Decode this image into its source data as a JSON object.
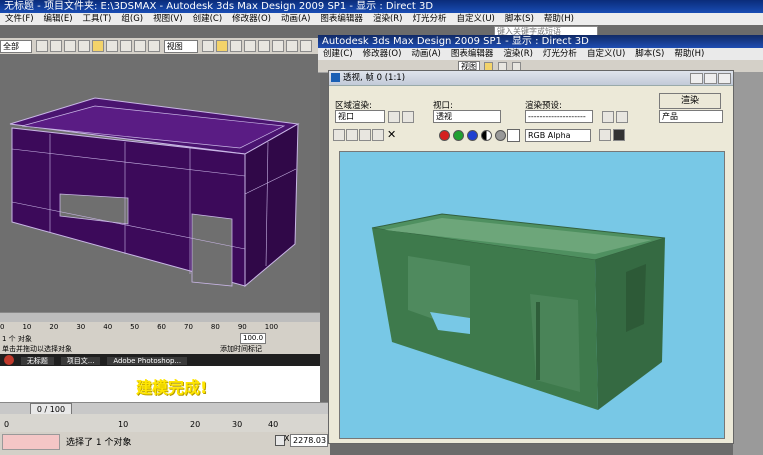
{
  "main": {
    "title": "无标题    - 项目文件夹: E:\\3DSMAX      - Autodesk 3ds Max Design 2009 SP1      - 显示 : Direct 3D",
    "menu": [
      "文件(F)",
      "编辑(E)",
      "工具(T)",
      "组(G)",
      "视图(V)",
      "创建(C)",
      "修改器(O)",
      "动画(A)",
      "图表编辑器",
      "渲染(R)",
      "灯光分析",
      "自定义(U)",
      "脚本(S)",
      "帮助(H)"
    ],
    "search_placeholder": "键入关键字或短语",
    "toolbar_combo_left": "全部",
    "toolbar_combo_view": "视图",
    "inner_title": "E:\\3DSMAX     - Autodesk 3ds Max Design 2009 SP1     - 显示 : Direct 3D",
    "inner_menu": [
      "文件(F)",
      "编辑(E)",
      "工具(T)",
      "组(G)",
      "视图(V)",
      "创建(C)",
      "修改器(O)",
      "动画(A)",
      "图表编辑器",
      "渲染(R)",
      "灯光分析",
      "自定义(U)",
      "脚本(S)",
      "帮助(H)"
    ],
    "frame_counter": "0 / 100",
    "small_frame_counter": "0 / 100",
    "selection_status": "选择了 1 个对象",
    "small_selection_status": "1 个 对象",
    "small_prompt": "单击并拖动以选择对象",
    "coord_x": "2278.03",
    "ruler": [
      "0",
      "10",
      "20",
      "30",
      "40"
    ],
    "small_ruler": [
      "0",
      "10",
      "20",
      "30",
      "40",
      "50",
      "60",
      "70",
      "80",
      "90",
      "100"
    ],
    "right_panel_label": "添加时间标记",
    "zoom_value": "100.0"
  },
  "taskbar": {
    "items": [
      "无标题",
      "项目文...",
      "Adobe Photoshop..."
    ]
  },
  "banner": {
    "text": "建模完成!",
    "color": "#ffe600"
  },
  "second_window": {
    "title": "Autodesk 3ds Max Design 2009 SP1     - 显示 : Direct 3D",
    "menu": [
      "创建(C)",
      "修改器(O)",
      "动画(A)",
      "图表编辑器",
      "渲染(R)",
      "灯光分析",
      "自定义(U)",
      "脚本(S)",
      "帮助(H)"
    ],
    "toolbar_combo": "视图"
  },
  "render_frame": {
    "title": "透视, 帧 0 (1:1)",
    "area_label": "区域渲染:",
    "area_value": "视口",
    "viewport_label": "视口:",
    "viewport_value": "透视",
    "preset_label": "渲染预设:",
    "preset_value": "--------------------",
    "render_button": "渲染",
    "product_value": "产品",
    "channel_value": "RGB Alpha",
    "bg_color": "#78c8e6",
    "model_color": "#3e7a4c"
  },
  "viewport": {
    "bg_color": "#6f6f6f",
    "model_color": "#3c0a5a"
  }
}
